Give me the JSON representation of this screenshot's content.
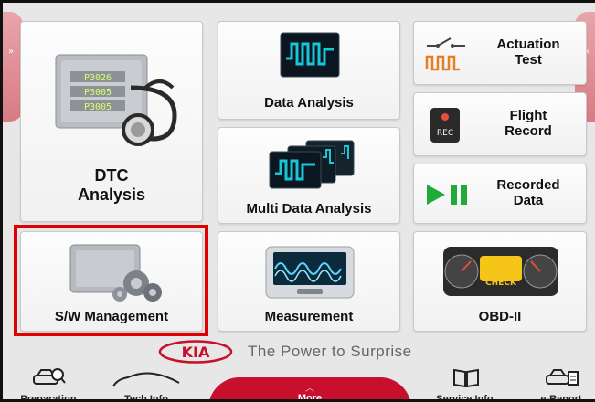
{
  "tiles": {
    "dtc_analysis": {
      "line1": "DTC",
      "line2": "Analysis"
    },
    "sw_management": {
      "label": "S/W Management"
    },
    "data_analysis": {
      "label": "Data Analysis"
    },
    "multi_data_analysis": {
      "label": "Multi Data Analysis"
    },
    "measurement": {
      "label": "Measurement"
    },
    "actuation_test": {
      "line1": "Actuation",
      "line2": "Test"
    },
    "flight_record": {
      "line1": "Flight",
      "line2": "Record",
      "icon_text": "REC"
    },
    "recorded_data": {
      "line1": "Recorded",
      "line2": "Data"
    },
    "obd2": {
      "label": "OBD-II",
      "icon_text": "CHECK"
    }
  },
  "ecu_codes": [
    "P3026",
    "P3005",
    "P3005"
  ],
  "side_tabs": {
    "left_glyph": "»",
    "right_glyph": "«"
  },
  "brand": {
    "logo_text": "KIA",
    "slogan": "The Power to Surprise"
  },
  "bottom_nav": {
    "preparation": "Preparation",
    "tech_info": "Tech Info",
    "more": "More",
    "service_info": "Service Info.",
    "e_report": "e-Report"
  },
  "colors": {
    "accent_red": "#c8102e",
    "highlight_red": "#e00000",
    "teal_wave": "#17c7d8",
    "green_play": "#1faa3a",
    "side_tab_pink": "#e9a5aa"
  },
  "icons": {
    "dtc": "ecu-stethoscope-icon",
    "sw": "ecu-gears-icon",
    "data_analysis": "waveform-monitor-icon",
    "multi_data_analysis": "multi-waveform-monitor-icon",
    "measurement": "oscilloscope-icon",
    "actuation": "switch-pulse-icon",
    "flight_record": "rec-device-icon",
    "recorded_data": "play-pause-icon",
    "obd2": "check-engine-dashboard-icon"
  }
}
